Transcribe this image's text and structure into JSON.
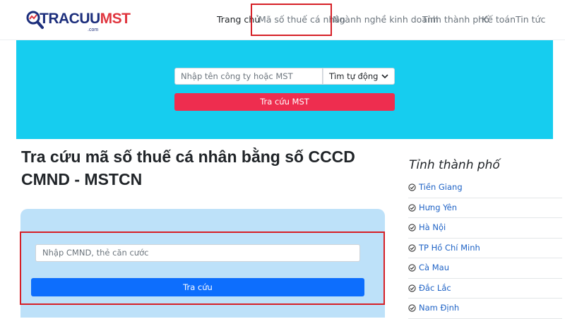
{
  "header": {
    "logo": {
      "text_main": "TRACUU",
      "text_accent": "MST",
      "suffix": ".com"
    },
    "nav": [
      {
        "label": "Trang chủ",
        "active": true
      },
      {
        "label": "Mã số thuế cá nhân",
        "active": false
      },
      {
        "label": "Ngành nghề kinh doanh",
        "active": false
      },
      {
        "label": "Tỉnh thành phố",
        "active": false
      },
      {
        "label": "Kế toán",
        "active": false
      },
      {
        "label": "Tin tức",
        "active": false
      }
    ]
  },
  "hero": {
    "search_placeholder": "Nhập tên công ty hoặc MST",
    "search_mode": "Tìm tự động",
    "search_button": "Tra cứu MST",
    "background_color": "#16cdef",
    "button_color": "#ee2d4f"
  },
  "main": {
    "title": "Tra cứu mã số thuế cá nhân bằng số CCCD CMND - MSTCN",
    "form": {
      "placeholder": "Nhập CMND, thẻ căn cước",
      "button": "Tra cứu",
      "button_color": "#0d6efd"
    }
  },
  "sidebar": {
    "title": "Tỉnh thành phố",
    "items": [
      {
        "label": "Tiền Giang"
      },
      {
        "label": "Hưng Yên"
      },
      {
        "label": "Hà Nội"
      },
      {
        "label": "TP Hồ Chí Minh"
      },
      {
        "label": "Cà Mau"
      },
      {
        "label": "Đắc Lắc"
      },
      {
        "label": "Nam Định"
      }
    ]
  },
  "icons": {
    "logo": "magnifier-logo-icon",
    "select": "chevron-down-icon",
    "list": "check-circle-icon"
  }
}
